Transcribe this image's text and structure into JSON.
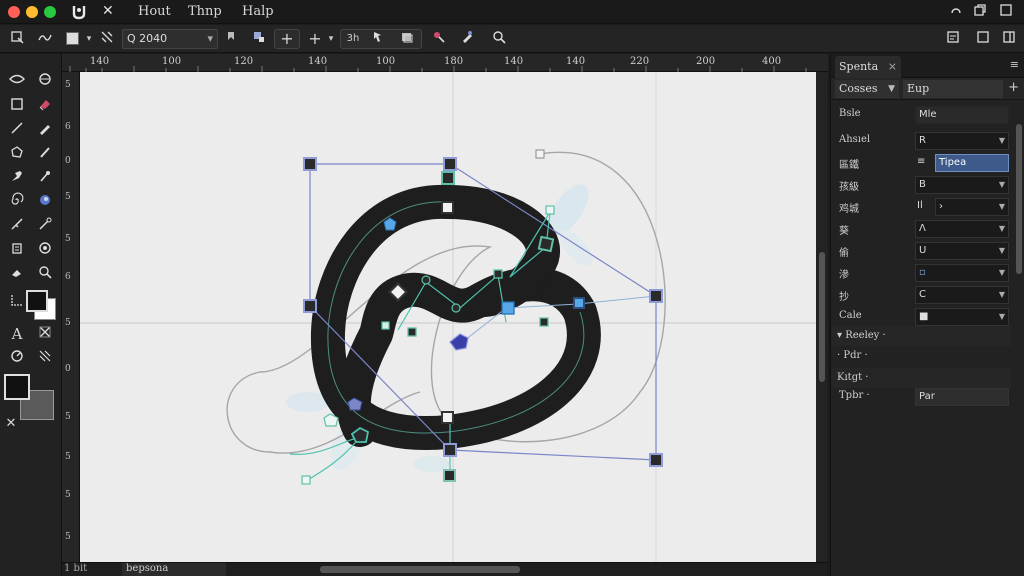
{
  "app": {
    "menu": [
      "Hout",
      "Thnp",
      "Halp"
    ],
    "traffic_colors": [
      "#ff5f57",
      "#febc2e",
      "#28c840"
    ]
  },
  "toolbar": {
    "zoom_value": "Q 2040",
    "zoom_icon": "magnifier-icon"
  },
  "rulers": {
    "horizontal": [
      "140",
      "100",
      "120",
      "140",
      "100",
      "180",
      "140",
      "140",
      "220",
      "200",
      "400"
    ],
    "vertical": [
      "5",
      "6",
      "0",
      "5",
      "5",
      "6",
      "5",
      "0",
      "5",
      "5",
      "5",
      "5",
      "6"
    ]
  },
  "statusbar": {
    "left": "1 bit",
    "tab": "bepsona"
  },
  "panel": {
    "tab": "Spenta",
    "tab_close": "×",
    "menu_icon": "≡",
    "select_value": "Cosses",
    "sub_label": "Eup",
    "plus": "+",
    "rows": [
      {
        "label": "Bsle",
        "icon": "",
        "value": "Mle",
        "style": "text-wide"
      },
      {
        "label": "Ahsıel",
        "icon": "",
        "value": "R",
        "style": "wide"
      },
      {
        "label": "區鐵",
        "icon": "≡",
        "value": "Tipea",
        "style": "sel"
      },
      {
        "label": "孩級",
        "icon": "",
        "value": "B",
        "style": "wide"
      },
      {
        "label": "鸡城",
        "icon": "Il",
        "value": "›",
        "style": "field"
      },
      {
        "label": "葵",
        "icon": "",
        "value": "Λ",
        "style": "wide"
      },
      {
        "label": "偷",
        "icon": "",
        "value": "U",
        "style": "wide"
      },
      {
        "label": "滲",
        "icon": "",
        "value": "▫",
        "style": "wide"
      },
      {
        "label": "抄",
        "icon": "",
        "value": "C",
        "style": "wide"
      },
      {
        "label": "Cale",
        "icon": "",
        "value": "■",
        "style": "wide"
      }
    ],
    "sections": [
      {
        "label": "▾ Reeley ·"
      },
      {
        "label": "· Pdr ·"
      },
      {
        "label": "Kıtgt ·"
      }
    ],
    "last_row": {
      "label": "Tpbr ·",
      "value": "Par"
    }
  }
}
